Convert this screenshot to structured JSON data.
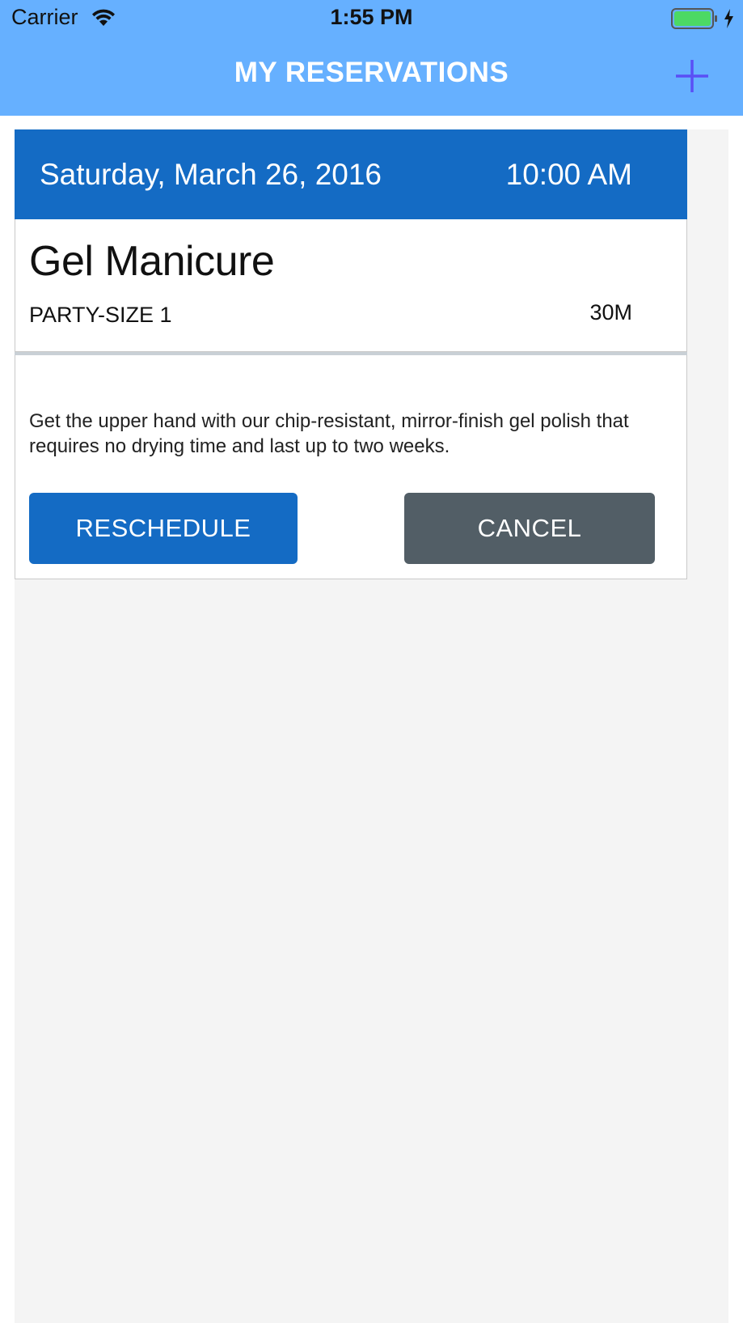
{
  "status_bar": {
    "carrier": "Carrier",
    "time": "1:55 PM",
    "battery_color": "#4cd964"
  },
  "nav": {
    "title": "MY RESERVATIONS",
    "add_icon": "plus-icon",
    "add_icon_color": "#5a4ff5",
    "background": "#66b0ff"
  },
  "reservation": {
    "date": "Saturday, March 26, 2016",
    "time": "10:00 AM",
    "service": "Gel Manicure",
    "party_size": "PARTY-SIZE 1",
    "duration": "30M",
    "description": "Get the upper hand with our chip-resistant, mirror-finish gel polish that requires no drying time and last up to two weeks.",
    "reschedule_label": "RESCHEDULE",
    "cancel_label": "CANCEL",
    "header_color": "#146bc4",
    "reschedule_color": "#146bc4",
    "cancel_color": "#525e66"
  }
}
